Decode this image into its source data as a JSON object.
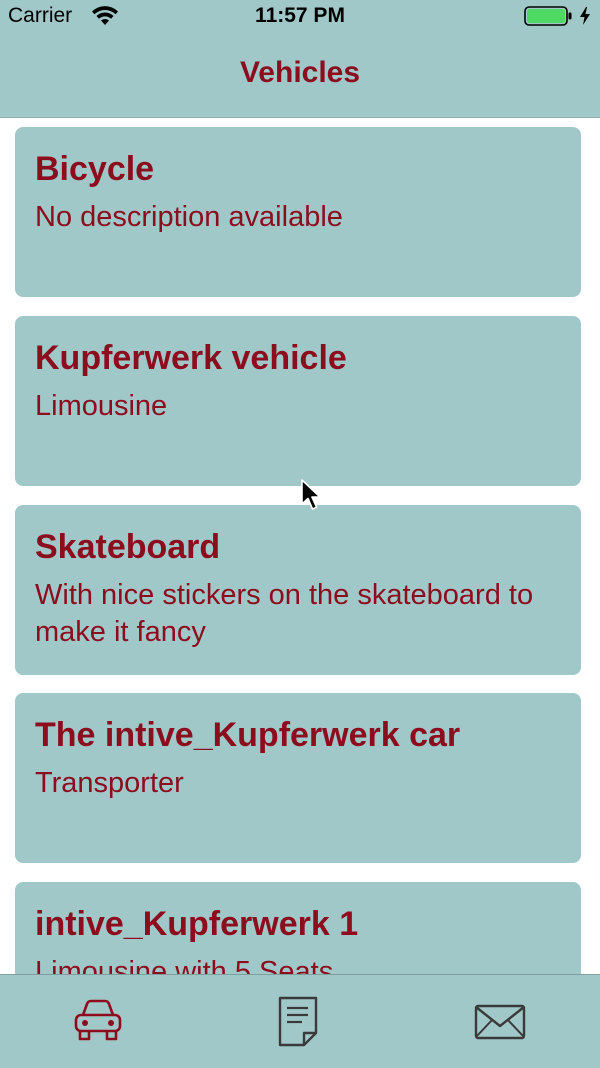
{
  "status_bar": {
    "carrier": "Carrier",
    "time": "11:57 PM",
    "battery_level": 1.0,
    "battery_color": "#4cd964"
  },
  "nav": {
    "title": "Vehicles"
  },
  "vehicles": [
    {
      "name": "Bicycle",
      "description": "No description available"
    },
    {
      "name": "Kupferwerk vehicle",
      "description": "Limousine"
    },
    {
      "name": "Skateboard",
      "description": "With nice stickers on the skateboard to make it fancy"
    },
    {
      "name": "The intive_Kupferwerk car",
      "description": "Transporter"
    },
    {
      "name": "intive_Kupferwerk 1",
      "description": "Limousine with 5 Seats"
    }
  ],
  "tabs": [
    {
      "icon": "car-icon",
      "selected": true
    },
    {
      "icon": "document-icon",
      "selected": false
    },
    {
      "icon": "envelope-icon",
      "selected": false
    }
  ],
  "colors": {
    "accent": "#8b0d1e",
    "surface": "#a1c8c8",
    "background": "#ffffff"
  }
}
